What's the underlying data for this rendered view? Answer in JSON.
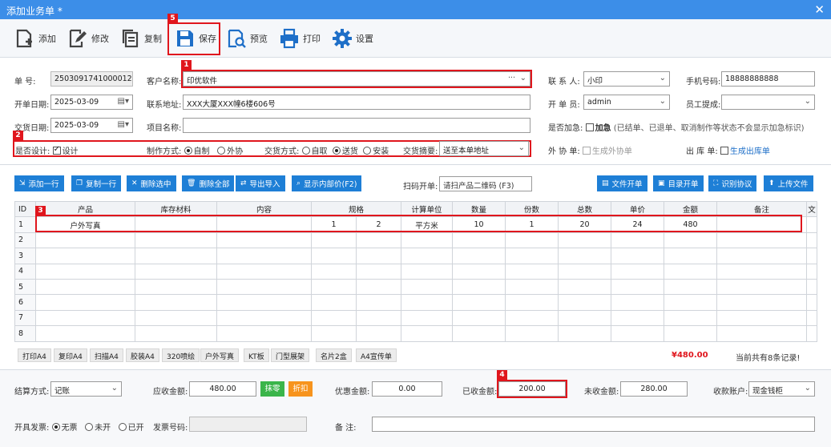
{
  "window": {
    "title": "添加业务单 *",
    "close": "✕"
  },
  "toolbar": {
    "add": "添加",
    "edit": "修改",
    "copy": "复制",
    "save": "保存",
    "preview": "预览",
    "print": "打印",
    "settings": "设置"
  },
  "badges": {
    "b1": "1",
    "b2": "2",
    "b3": "3",
    "b4": "4",
    "b5": "5"
  },
  "form": {
    "order_no_label": "单    号:",
    "order_no": "2503091741000012",
    "customer_label": "客户名称:",
    "customer": "印优软件",
    "customer_dots": "···",
    "contact_label": "联 系 人:",
    "contact": "小印",
    "phone_label": "手机号码:",
    "phone": "18888888888",
    "open_date_label": "开单日期:",
    "open_date": "2025-03-09",
    "address_label": "联系地址:",
    "address": "XXX大厦XXX幢6楼606号",
    "clerk_label": "开 单 员:",
    "clerk": "admin",
    "commission_label": "员工提成:",
    "commission": "",
    "delivery_date_label": "交货日期:",
    "delivery_date": "2025-03-09",
    "project_label": "项目名称:",
    "project": "",
    "urgent_label": "是否加急:",
    "urgent_opt": "加急",
    "urgent_note": "(已结单、已退单、取消制作等状态不会显示加急标识)",
    "design_label": "是否设计:",
    "design_opt": "设计",
    "make_label": "制作方式:",
    "make_self": "自制",
    "make_out": "外协",
    "deliver_label": "交货方式:",
    "deliver_pick": "自取",
    "deliver_send": "送货",
    "deliver_install": "安装",
    "deliver_summary_label": "交货摘要:",
    "deliver_summary": "送至本单地址",
    "outsource_label": "外 协 单:",
    "outsource_opt": "生成外协单",
    "outbound_label": "出 库 单:",
    "outbound_opt": "生成出库单"
  },
  "actions": {
    "add_row": "添加一行",
    "copy_row": "复制一行",
    "del_sel": "删除选中",
    "del_all": "删除全部",
    "export": "导出导入",
    "show_parts": "显示内部价(F2)",
    "scan_label": "扫码开单:",
    "scan_placeholder": "请扫产品二维码 (F3)",
    "file_order": "文件开单",
    "dir_order": "目录开单",
    "recognize": "识别协议",
    "upload": "上传文件"
  },
  "table": {
    "headers": [
      "ID",
      "产品",
      "库存材料",
      "内容",
      "规格",
      "",
      "计算单位",
      "数量",
      "份数",
      "总数",
      "单价",
      "金额",
      "备注",
      "文"
    ],
    "row1": [
      "1",
      "户外写真",
      "",
      "",
      "1",
      "2",
      "平方米",
      "10",
      "1",
      "20",
      "24",
      "480",
      "",
      ""
    ],
    "row_ids": [
      "2",
      "3",
      "4",
      "5",
      "6",
      "7",
      "8"
    ]
  },
  "quick_tags": [
    "打印A4",
    "复印A4",
    "扫描A4",
    "胶装A4",
    "320喷绘",
    "户外写真",
    "KT板",
    "门型展架",
    "名片2盒",
    "A4宣传单"
  ],
  "summary": {
    "total": "¥480.00",
    "records": "当前共有8条记录!"
  },
  "settle": {
    "method_label": "结算方式:",
    "method": "记账",
    "receivable_label": "应收金额:",
    "receivable": "480.00",
    "round_btn": "抹零",
    "discount_btn": "折扣",
    "discount_label": "优惠金额:",
    "discount": "0.00",
    "received_label": "已收金额:",
    "received": "200.00",
    "unpaid_label": "未收金额:",
    "unpaid": "280.00",
    "account_label": "收款账户:",
    "account": "现金钱柜"
  },
  "invoice": {
    "label": "开具发票:",
    "none": "无票",
    "not_open": "未开",
    "opened": "已开",
    "no_label": "发票号码:",
    "note_label": "备    注:"
  },
  "colors": {
    "accent": "#1e7fd6",
    "title": "#3c8ee8",
    "highlight": "#e0161d",
    "green": "#3bb54a",
    "orange": "#f7941d"
  }
}
